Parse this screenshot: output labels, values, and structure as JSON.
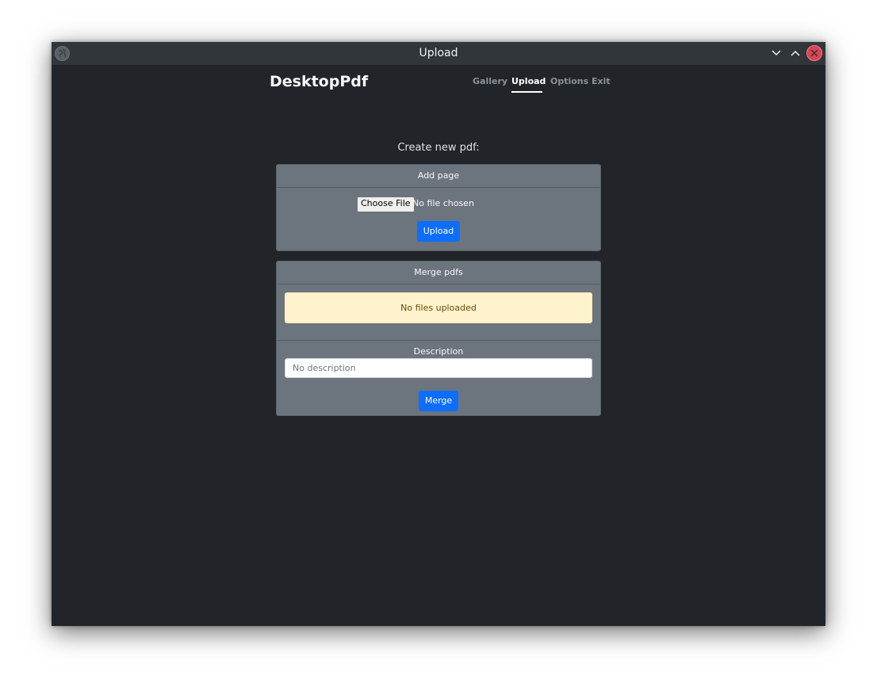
{
  "window": {
    "title": "Upload",
    "app_icon": "globe-icon",
    "controls": [
      "minimize-icon",
      "maximize-icon",
      "close-icon"
    ]
  },
  "navbar": {
    "brand": "DesktopPdf",
    "links": [
      {
        "label": "Gallery",
        "active": false
      },
      {
        "label": "Upload",
        "active": true
      },
      {
        "label": "Options",
        "active": false
      },
      {
        "label": "Exit",
        "active": false
      }
    ]
  },
  "main": {
    "heading": "Create new pdf:",
    "add_page": {
      "header": "Add page",
      "choose_file_label": "Choose File",
      "file_status": "No file chosen",
      "upload_label": "Upload"
    },
    "merge": {
      "header": "Merge pdfs",
      "alert": "No files uploaded",
      "description_label": "Description",
      "description_placeholder": "No description",
      "merge_label": "Merge"
    }
  },
  "colors": {
    "background": "#212529",
    "card": "#6c757d",
    "primary": "#0d6efd",
    "alert": "#fff3cd",
    "close": "#da4453"
  }
}
